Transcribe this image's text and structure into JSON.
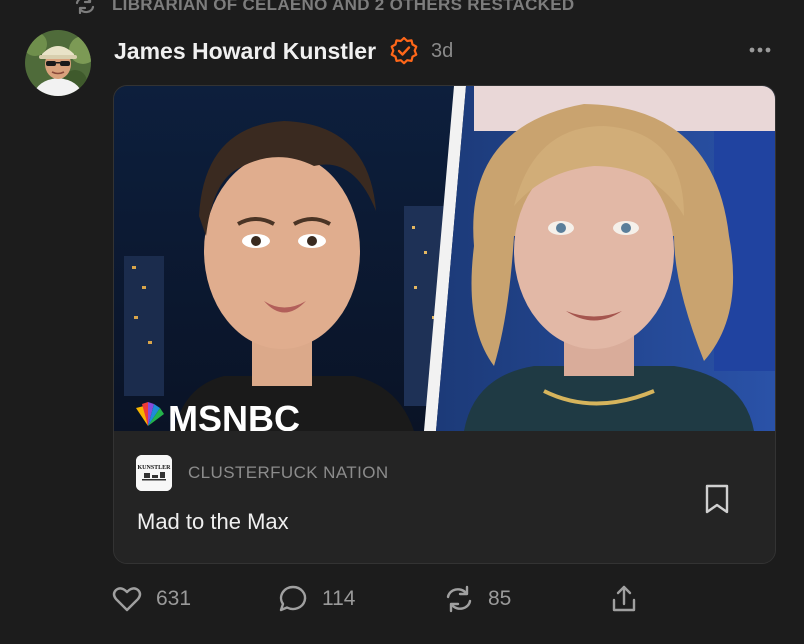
{
  "restack": {
    "icon": "restack-icon",
    "text": "LIBRARIAN OF CELAENO AND 2 OTHERS RESTACKED"
  },
  "post": {
    "author": "James Howard Kunstler",
    "verified_icon": "verified-check-icon",
    "timestamp": "3d",
    "more_icon": "more-dots-icon"
  },
  "card": {
    "image_text": "MSNBC",
    "publication": "CLUSTERFUCK NATION",
    "publication_logo_text": "KUNSTLER",
    "title": "Mad to the Max",
    "bookmark_icon": "bookmark-icon"
  },
  "actions": {
    "likes": "631",
    "comments": "114",
    "restacks": "85",
    "share_icon": "share-icon"
  },
  "colors": {
    "background": "#1c1c1c",
    "accent": "#ff6719",
    "card": "#262626"
  }
}
